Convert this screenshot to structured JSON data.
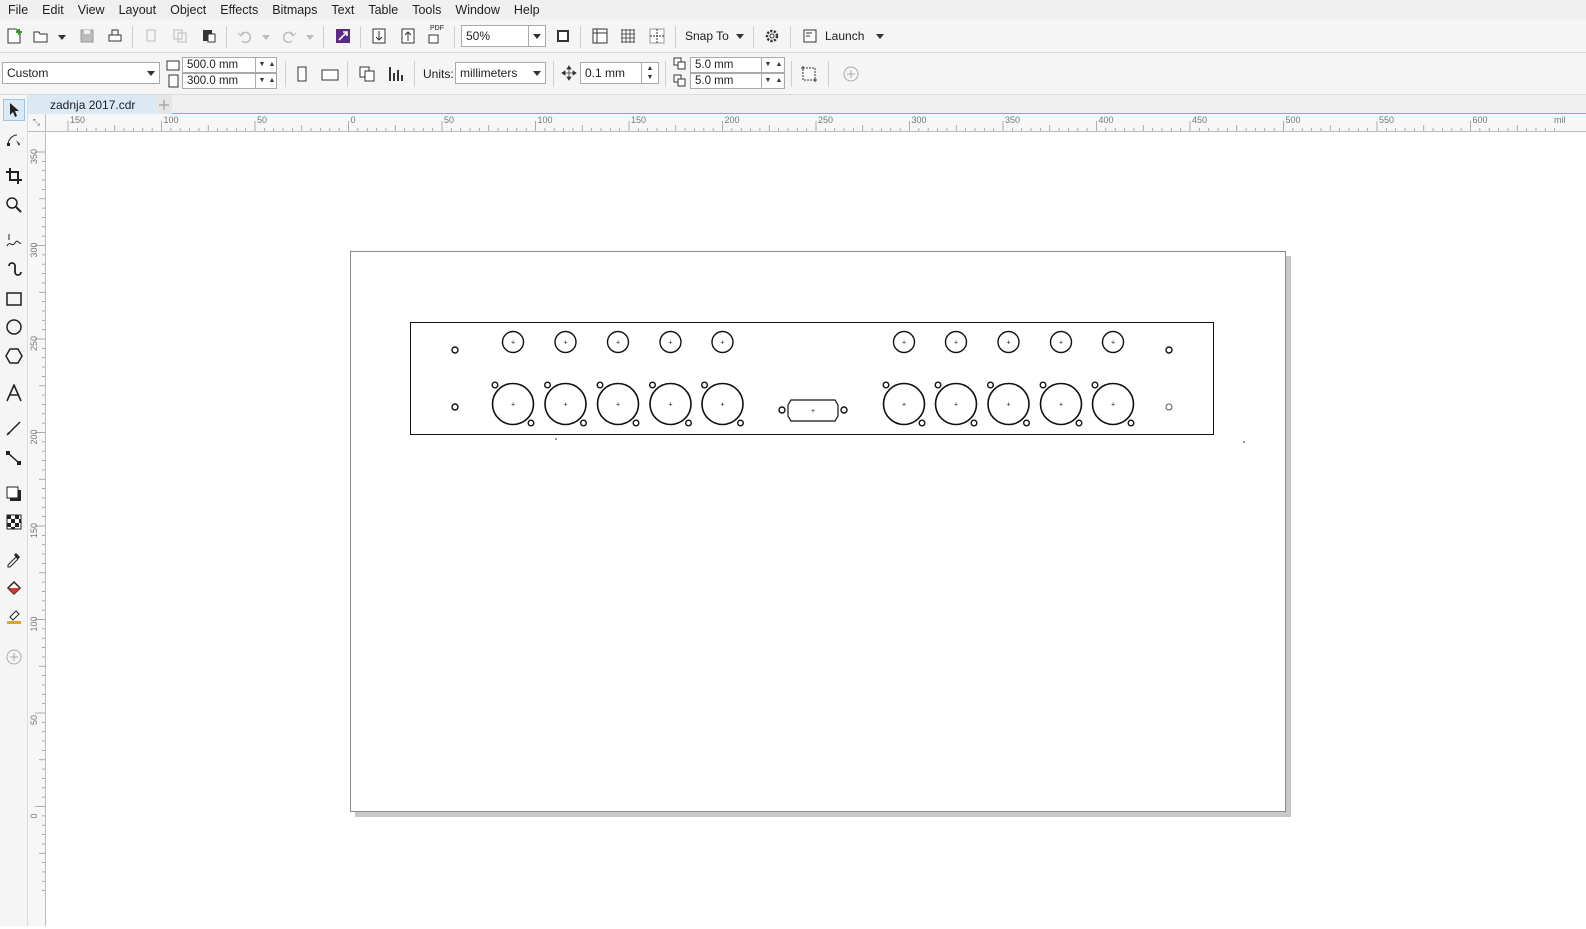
{
  "menu": [
    "File",
    "Edit",
    "View",
    "Layout",
    "Object",
    "Effects",
    "Bitmaps",
    "Text",
    "Table",
    "Tools",
    "Window",
    "Help"
  ],
  "toolbar": {
    "zoom_value": "50%",
    "snap_label": "Snap To",
    "launch_label": "Launch",
    "pdf_label": "PDF"
  },
  "property_bar": {
    "page_preset": "Custom",
    "page_width": "500.0 mm",
    "page_height": "300.0 mm",
    "units_label": "Units:",
    "units_value": "millimeters",
    "nudge_value": "0.1 mm",
    "duplicate_x": "5.0 mm",
    "duplicate_y": "5.0 mm"
  },
  "document_tab": {
    "name": "zadnja 2017.cdr"
  },
  "rulers": {
    "horizontal_ticks": [
      "150",
      "100",
      "50",
      "0",
      "50",
      "100",
      "150",
      "200",
      "250",
      "300",
      "350",
      "400",
      "450",
      "500",
      "550",
      "600"
    ],
    "horizontal_unit": "mil",
    "vertical_ticks": [
      "350",
      "300",
      "250",
      "200",
      "150",
      "100",
      "50",
      "0"
    ]
  },
  "colors": {
    "tab_active": "#dbe9f5",
    "tab_underline": "#6cb3d9",
    "page_shadow": "#c8c8c8"
  },
  "icons": {
    "toolbox": [
      "pick-tool-icon",
      "shape-tool-icon",
      "crop-tool-icon",
      "zoom-tool-icon",
      "freehand-tool-icon",
      "artistic-media-icon",
      "rectangle-tool-icon",
      "ellipse-tool-icon",
      "polygon-tool-icon",
      "text-tool-icon",
      "parallel-dimension-icon",
      "connector-tool-icon",
      "drop-shadow-icon",
      "transparency-icon",
      "eyedropper-icon",
      "interactive-fill-icon",
      "smart-fill-icon",
      "add-tool-icon"
    ]
  }
}
